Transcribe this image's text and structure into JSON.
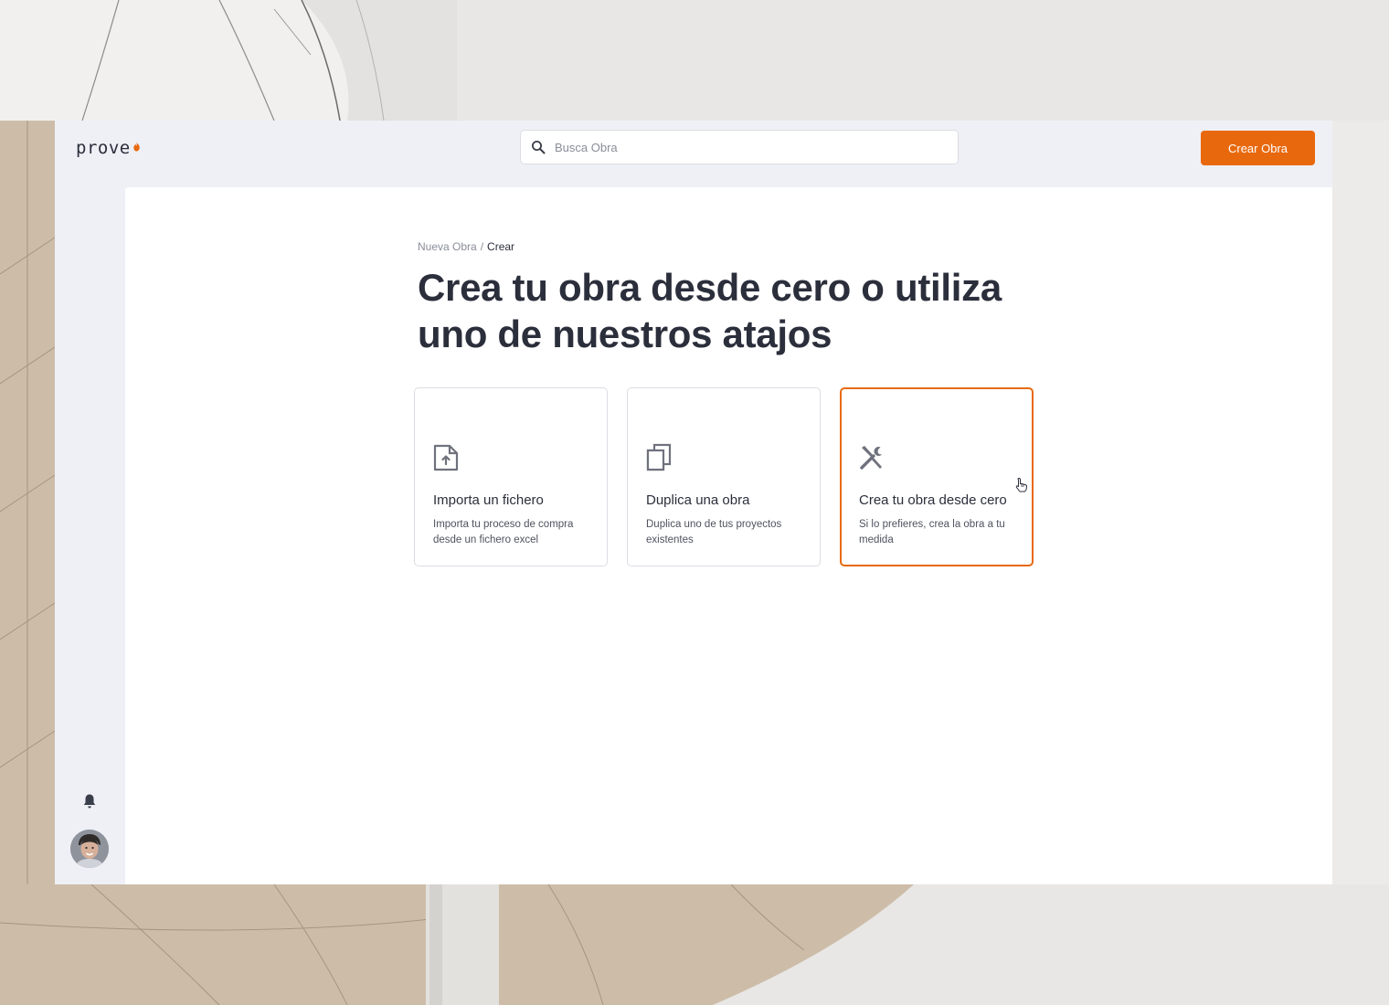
{
  "brand": {
    "logo_text": "prove",
    "accent_color": "#e8690d"
  },
  "header": {
    "search_placeholder": "Busca Obra",
    "create_button_label": "Crear Obra"
  },
  "breadcrumb": {
    "parent": "Nueva Obra",
    "separator": "/",
    "current": "Crear"
  },
  "page_title": "Crea tu obra desde cero o utiliza uno de nuestros atajos",
  "options": [
    {
      "icon": "file-upload-icon",
      "title": "Importa un fichero",
      "description": "Importa tu proceso de compra desde un fichero excel",
      "selected": false
    },
    {
      "icon": "copy-icon",
      "title": "Duplica una obra",
      "description": "Duplica uno de tus proyectos existentes",
      "selected": false
    },
    {
      "icon": "tools-icon",
      "title": "Crea tu obra desde cero",
      "description": "Si lo prefieres, crea la obra a tu medida",
      "selected": true
    }
  ],
  "sidebar": {
    "notifications_icon": "bell-icon",
    "user_avatar": "avatar"
  }
}
